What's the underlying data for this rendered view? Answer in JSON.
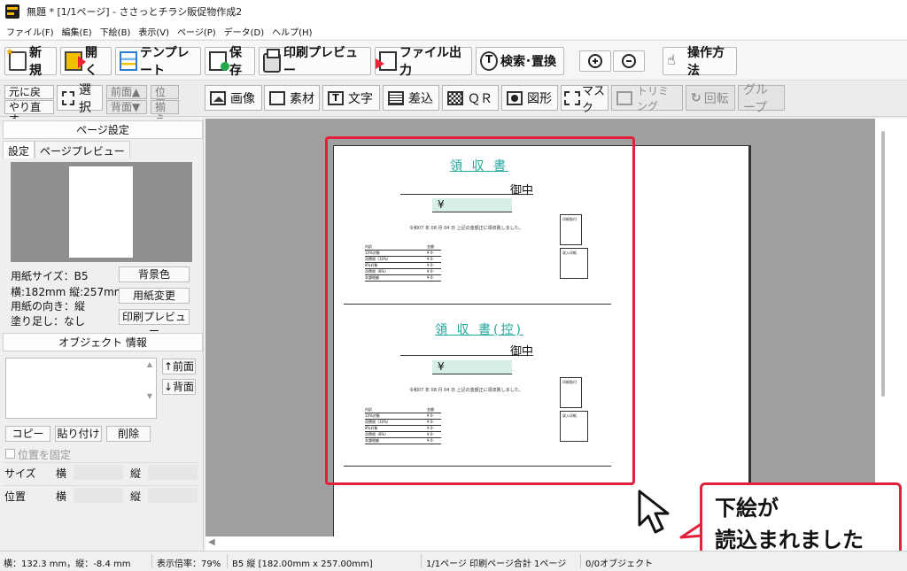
{
  "window": {
    "title": "無題 * [1/1ページ] - ささっとチラシ販促物作成2"
  },
  "menu": [
    "ファイル(F)",
    "編集(E)",
    "下絵(B)",
    "表示(V)",
    "ページ(P)",
    "データ(D)",
    "ヘルプ(H)"
  ],
  "toolbar1": {
    "new": "新規",
    "open": "開く",
    "template": "テンプレート",
    "save": "保存",
    "print_preview": "印刷プレビュー",
    "export": "ファイル出力",
    "search_replace": "検索･置換",
    "zoom_in": "zoom-in-icon",
    "zoom_out": "zoom-out-icon",
    "help": "操作方法"
  },
  "toolbar2": {
    "undo": "元に戻す",
    "redo": "やり直す",
    "select": "選択",
    "front": "前面▲",
    "back": "背面▼",
    "align1": "位置",
    "align2": "揃え",
    "image": "画像",
    "material": "素材",
    "text": "文字",
    "merge": "差込",
    "qr": "ＱＲ",
    "shape": "図形",
    "mask": "マスク",
    "trim": "トリミング",
    "rotate": "回転",
    "group": "グループ"
  },
  "page_settings": {
    "header": "ページ設定",
    "tabs": [
      "設定",
      "ページプレビュー"
    ],
    "paper_size": "用紙サイズ：B5",
    "dimensions": "横:182mm 縦:257mm",
    "orientation": "用紙の向き：縦",
    "bleed": "塗り足し：なし",
    "btn_bg": "背景色",
    "btn_change": "用紙変更",
    "btn_print": "印刷プレビュー"
  },
  "object_info": {
    "header": "オブジェクト 情報",
    "front": "↑前面",
    "back": "↓背面",
    "copy": "コピー",
    "paste": "貼り付け",
    "delete": "削除",
    "lock_position": "位置を固定",
    "size_label": "サイズ",
    "pos_label": "位置",
    "width": "横",
    "height": "縦"
  },
  "receipt": {
    "title1": "領 収 書",
    "title2": "領 収 書(控)",
    "recipient": "御中",
    "yen": "¥",
    "date": "令和07 年 08 月 04 日 上記の金額正に領収致しました。",
    "box1": "印紙貼付",
    "box2": "収入印紙",
    "table_head": [
      "内訳",
      "金額"
    ],
    "rows": [
      [
        "10%対象",
        "¥ 0-"
      ],
      [
        "消費税（10%）",
        "¥ 0-"
      ],
      [
        "8%対象",
        "¥ 0-"
      ],
      [
        "消費税（8%）",
        "¥ 0-"
      ],
      [
        "非課税額",
        "¥ 0-"
      ]
    ]
  },
  "callout": {
    "line1": "下絵が",
    "line2": "読込まれました"
  },
  "status": {
    "coords": "横：132.3 mm，縦：-8.4 mm",
    "zoom": "表示倍率：79%",
    "paper": "B5 縦 [182.00mm x 257.00mm]",
    "pages": "1/1ページ 印刷ページ合計 1ページ",
    "objects": "0/0オブジェクト"
  },
  "colors": {
    "accent_red": "#e0213c",
    "receipt_teal": "#22a69b",
    "amount_fill": "#d7efe6"
  }
}
